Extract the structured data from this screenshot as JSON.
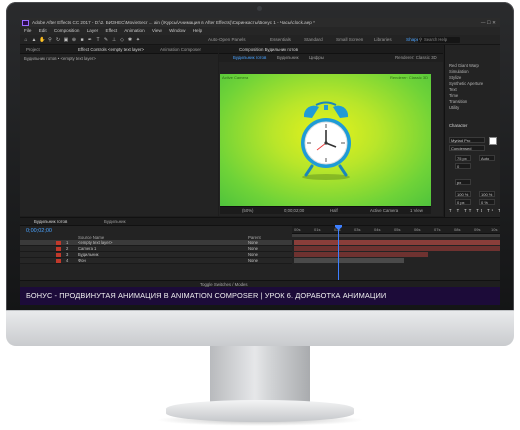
{
  "window": {
    "title": "Adobe After Effects CC 2017 - D:\\2. БИЗНЕС\\MovieSecr ... ain (\\Курсы\\Анимация в After Effects)\\Скринкасты\\Бонус 1 - Часы\\clock.aep *",
    "window_controls": "— ☐ ✕"
  },
  "menu": {
    "items": [
      "File",
      "Edit",
      "Composition",
      "Layer",
      "Effect",
      "Animation",
      "View",
      "Window",
      "Help"
    ]
  },
  "toolbar": {
    "auto_open_panels": "Auto-Open Panels",
    "workspaces": [
      "Essentials",
      "Standard",
      "Small Screen",
      "Libraries",
      "Shape"
    ],
    "active_workspace": "Shape",
    "search_placeholder": "Search Help"
  },
  "project_panel": {
    "tabs": [
      "Project",
      "Effect Controls <empty text layer>",
      "Animation Composer"
    ],
    "breadcrumb": "Будильник готов • <empty text layer>"
  },
  "composition_panel": {
    "tab": "Composition Будильник готов",
    "subtabs": [
      "Будильник готов",
      "Будильник",
      "Цифры"
    ],
    "comp_name_label": "Active Camera",
    "renderer_label": "Renderer: Classic 3D",
    "viewer_label": "Active Camera",
    "footer": {
      "zoom": "(50%)",
      "timecode": "0;00;02;00",
      "resolution": "Half",
      "view": "Active Camera",
      "views": "1 View"
    }
  },
  "right_panel": {
    "effects": [
      "Red Giant Warp",
      "Simulation",
      "Stylize",
      "Synthetic Aperture",
      "Text",
      "Time",
      "Transition",
      "Utility"
    ],
    "character_title": "Character",
    "font_family": "Myriad Pro",
    "font_style": "Condensed",
    "size": "75 px",
    "leading": "Auto",
    "tracking": "0",
    "vscale": "100 %",
    "hscale": "100 %",
    "stroke": "px",
    "baseline": "0 px",
    "tsume": "0 %"
  },
  "timeline": {
    "tabs": [
      "Будильник готов",
      "Будильник"
    ],
    "timecode": "0;00;02;00",
    "column_header": "Source Name",
    "parent_header": "Parent",
    "layers": [
      {
        "num": "1",
        "name": "<empty text layer>",
        "parent": "None",
        "selected": true
      },
      {
        "num": "2",
        "name": "Camera 1",
        "parent": "None",
        "selected": false
      },
      {
        "num": "3",
        "name": "Будильник",
        "parent": "None",
        "selected": false
      },
      {
        "num": "4",
        "name": "Фон",
        "parent": "None",
        "selected": false
      }
    ],
    "ruler_ticks": [
      "00s",
      "01s",
      "02s",
      "03s",
      "04s",
      "05s",
      "06s",
      "07s",
      "08s",
      "09s",
      "10s"
    ],
    "footer": "Toggle Switches / Modes"
  },
  "banner": {
    "text": "БОНУС - ПРОДВИНУТАЯ АНИМАЦИЯ В ANIMATION COMPOSER | УРОК 6. ДОРАБОТКА АНИМАЦИИ"
  },
  "colors": {
    "accent": "#4aa3ff",
    "label_red": "#c0392b",
    "banner_bg": "#1c0b39",
    "clock_blue": "#1f9bd6"
  }
}
